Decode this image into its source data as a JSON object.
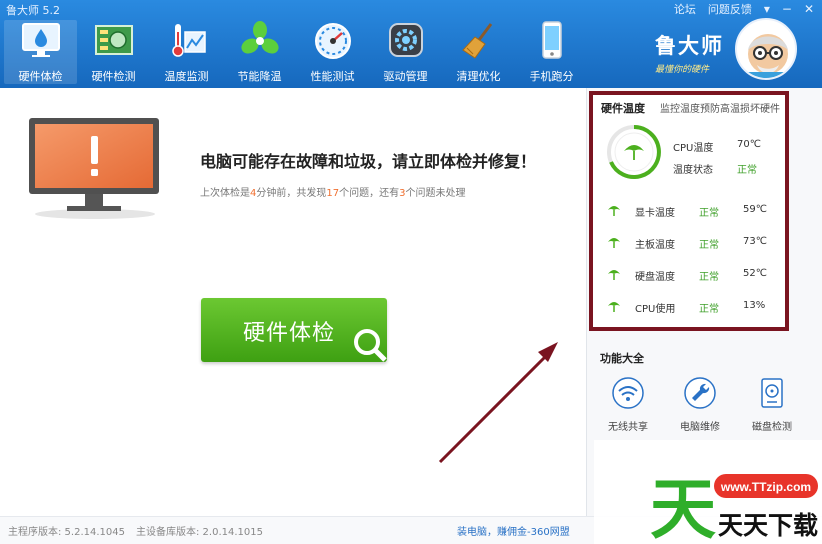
{
  "window": {
    "title": "鲁大师 5.2",
    "forum": "论坛",
    "feedback": "问题反馈"
  },
  "tabs": [
    {
      "label": "硬件体检",
      "icon": "monitor-droplet-icon",
      "active": true
    },
    {
      "label": "硬件检测",
      "icon": "circuit-board-icon",
      "active": false
    },
    {
      "label": "温度监测",
      "icon": "thermometer-chart-icon",
      "active": false
    },
    {
      "label": "节能降温",
      "icon": "fan-icon",
      "active": false
    },
    {
      "label": "性能测试",
      "icon": "speedometer-icon",
      "active": false
    },
    {
      "label": "驱动管理",
      "icon": "gear-box-icon",
      "active": false
    },
    {
      "label": "清理优化",
      "icon": "broom-icon",
      "active": false
    },
    {
      "label": "手机跑分",
      "icon": "phone-icon",
      "active": false
    }
  ],
  "brand": {
    "name": "鲁大师",
    "slogan": "最懂你的硬件"
  },
  "alert": {
    "title": "电脑可能存在故障和垃圾，请立即体检并修复！",
    "sub_prefix": "上次体检是",
    "minutes": "4",
    "sub_mid1": "分钟前，共发现",
    "issues": "17",
    "sub_mid2": "个问题，还有",
    "pending": "3",
    "sub_suffix": "个问题未处理"
  },
  "check_button": "硬件体检",
  "temperature": {
    "heading": "硬件温度",
    "tagline": "监控温度预防高温损坏硬件",
    "cpu_label": "CPU温度",
    "cpu_value": "70℃",
    "state_label": "温度状态",
    "state_value": "正常",
    "items": [
      {
        "name": "显卡温度",
        "status": "正常",
        "value": "59℃"
      },
      {
        "name": "主板温度",
        "status": "正常",
        "value": "73℃"
      },
      {
        "name": "硬盘温度",
        "status": "正常",
        "value": "52℃"
      },
      {
        "name": "CPU使用",
        "status": "正常",
        "value": "13%"
      }
    ]
  },
  "functions": {
    "title": "功能大全",
    "items": [
      {
        "label": "无线共享",
        "icon": "wifi-icon"
      },
      {
        "label": "电脑维修",
        "icon": "wrench-icon"
      },
      {
        "label": "磁盘检测",
        "icon": "disk-icon"
      }
    ]
  },
  "status_bar": {
    "main_version": "主程序版本: 5.2.14.1045",
    "db_version": "主设备库版本: 2.0.14.1015",
    "link": "装电脑，赚佣金-360网盟"
  },
  "watermark": {
    "url": "www.TTzip.com",
    "text": "天天下载"
  },
  "colors": {
    "header_blue": "#1a73c8",
    "accent_green": "#4cb01e",
    "frame_red": "#7a1420",
    "highlight_orange": "#f07030"
  }
}
